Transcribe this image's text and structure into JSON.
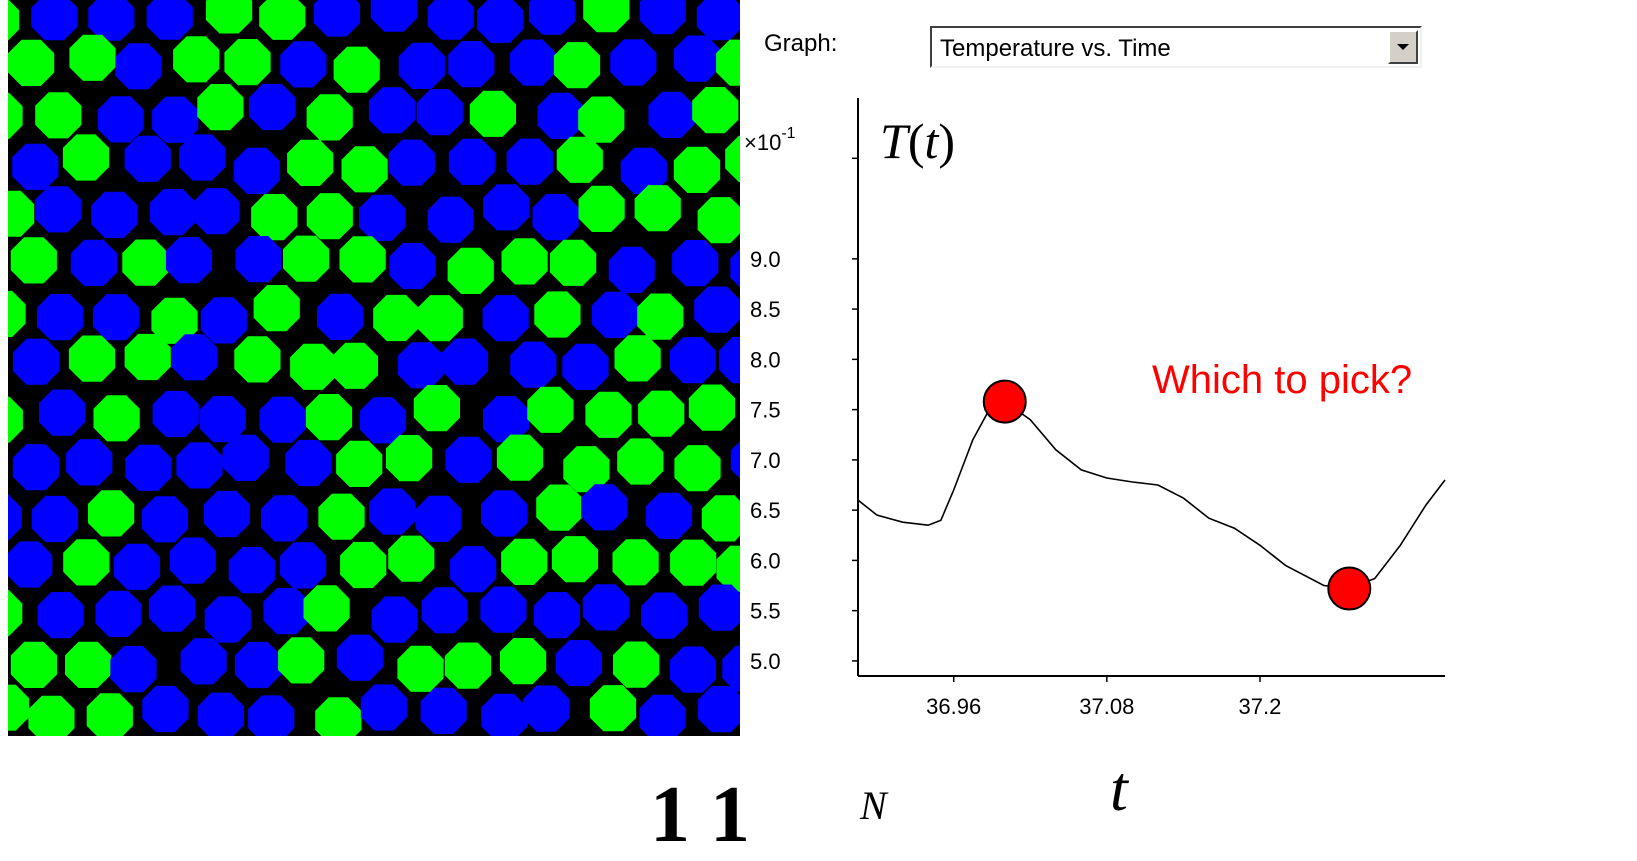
{
  "simulation": {
    "colors": {
      "background": "#000000",
      "green": "#00ff00",
      "blue": "#0000ff"
    }
  },
  "graph_selector": {
    "label": "Graph:",
    "selected": "Temperature vs. Time"
  },
  "chart_data": {
    "type": "line",
    "title": "T(t)",
    "xlabel": "t",
    "ylabel": "",
    "y_multiplier_label": "×10-1",
    "x_ticks": [
      "36.96",
      "37.08",
      "37.2"
    ],
    "y_ticks": [
      "5.0",
      "5.5",
      "6.0",
      "6.5",
      "7.0",
      "7.5",
      "8.0",
      "8.5",
      "9.0"
    ],
    "xlim": [
      36.885,
      37.345
    ],
    "ylim": [
      4.85,
      10.6
    ],
    "series": [
      {
        "x": [
          36.885,
          36.9,
          36.92,
          36.94,
          36.95,
          36.96,
          36.975,
          36.99,
          37.0,
          37.02,
          37.04,
          37.06,
          37.08,
          37.1,
          37.12,
          37.14,
          37.16,
          37.18,
          37.2,
          37.22,
          37.25,
          37.27,
          37.29,
          37.31,
          37.33,
          37.345
        ],
        "y": [
          6.6,
          6.45,
          6.38,
          6.35,
          6.4,
          6.7,
          7.2,
          7.55,
          7.58,
          7.4,
          7.1,
          6.9,
          6.82,
          6.78,
          6.75,
          6.62,
          6.42,
          6.32,
          6.15,
          5.95,
          5.75,
          5.72,
          5.82,
          6.15,
          6.55,
          6.8
        ]
      }
    ],
    "markers": [
      {
        "x": 37.0,
        "y": 7.58,
        "color": "#ff0000"
      },
      {
        "x": 37.27,
        "y": 5.72,
        "color": "#ff0000"
      }
    ],
    "annotation": "Which to pick?",
    "annotation_color": "#ff0000"
  },
  "footer": {
    "math_fragment": "1 1",
    "superscript": "N",
    "variable": "t"
  }
}
